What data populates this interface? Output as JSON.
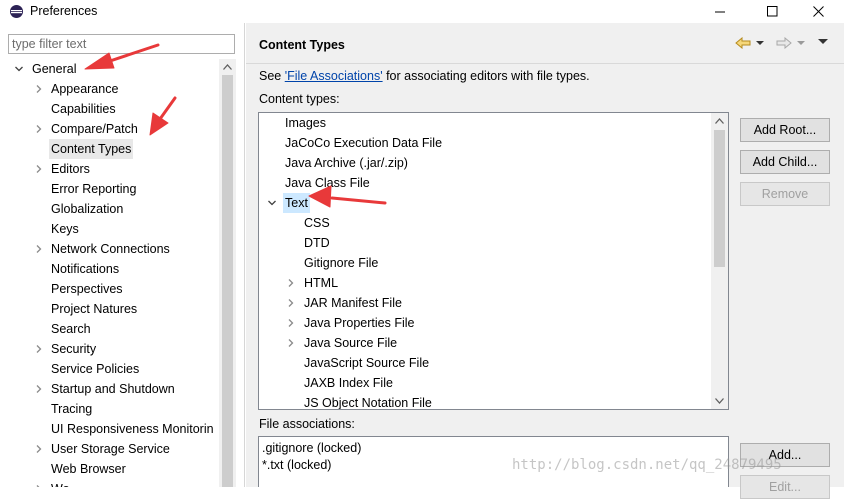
{
  "window": {
    "title": "Preferences"
  },
  "left": {
    "filter_placeholder": "type filter text",
    "tree": [
      {
        "label": "General",
        "expander": "expanded"
      },
      {
        "label": "Appearance",
        "expander": "collapsed"
      },
      {
        "label": "Capabilities",
        "expander": "none"
      },
      {
        "label": "Compare/Patch",
        "expander": "collapsed"
      },
      {
        "label": "Content Types",
        "expander": "none",
        "selected": true
      },
      {
        "label": "Editors",
        "expander": "collapsed"
      },
      {
        "label": "Error Reporting",
        "expander": "none"
      },
      {
        "label": "Globalization",
        "expander": "none"
      },
      {
        "label": "Keys",
        "expander": "none"
      },
      {
        "label": "Network Connections",
        "expander": "collapsed"
      },
      {
        "label": "Notifications",
        "expander": "none"
      },
      {
        "label": "Perspectives",
        "expander": "none"
      },
      {
        "label": "Project Natures",
        "expander": "none"
      },
      {
        "label": "Search",
        "expander": "none"
      },
      {
        "label": "Security",
        "expander": "collapsed"
      },
      {
        "label": "Service Policies",
        "expander": "none"
      },
      {
        "label": "Startup and Shutdown",
        "expander": "collapsed"
      },
      {
        "label": "Tracing",
        "expander": "none"
      },
      {
        "label": "UI Responsiveness Monitorin",
        "expander": "none"
      },
      {
        "label": "User Storage Service",
        "expander": "collapsed"
      },
      {
        "label": "Web Browser",
        "expander": "none"
      },
      {
        "label": "Wo",
        "expander": "collapsed"
      }
    ]
  },
  "right": {
    "title": "Content Types",
    "description": {
      "prefix": "See ",
      "link": "'File Associations'",
      "suffix": " for associating editors with file types."
    },
    "content_types_label": "Content types:",
    "content_types": [
      {
        "label": "Images",
        "expander": "none",
        "level": 0
      },
      {
        "label": "JaCoCo Execution Data File",
        "expander": "none",
        "level": 0
      },
      {
        "label": "Java Archive (.jar/.zip)",
        "expander": "none",
        "level": 0
      },
      {
        "label": "Java Class File",
        "expander": "none",
        "level": 0
      },
      {
        "label": "Text",
        "expander": "expanded",
        "level": 0,
        "selected": true
      },
      {
        "label": "CSS",
        "expander": "none",
        "level": 1
      },
      {
        "label": "DTD",
        "expander": "none",
        "level": 1
      },
      {
        "label": "Gitignore File",
        "expander": "none",
        "level": 1
      },
      {
        "label": "HTML",
        "expander": "collapsed",
        "level": 1
      },
      {
        "label": "JAR Manifest File",
        "expander": "collapsed",
        "level": 1
      },
      {
        "label": "Java Properties File",
        "expander": "collapsed",
        "level": 1
      },
      {
        "label": "Java Source File",
        "expander": "collapsed",
        "level": 1
      },
      {
        "label": "JavaScript Source File",
        "expander": "none",
        "level": 1
      },
      {
        "label": "JAXB Index File",
        "expander": "none",
        "level": 1
      },
      {
        "label": "JS Object Notation File",
        "expander": "none",
        "level": 1
      }
    ],
    "buttons": {
      "add_root": "Add Root...",
      "add_child": "Add Child...",
      "remove": "Remove",
      "add": "Add...",
      "edit": "Edit..."
    },
    "file_associations_label": "File associations:",
    "file_associations": [
      ".gitignore (locked)",
      "*.txt (locked)"
    ]
  },
  "watermark": "http://blog.csdn.net/qq_24879495",
  "colors": {
    "selection": "#cce8ff",
    "annotation_arrow": "#e8393a",
    "link": "#0044aa"
  }
}
